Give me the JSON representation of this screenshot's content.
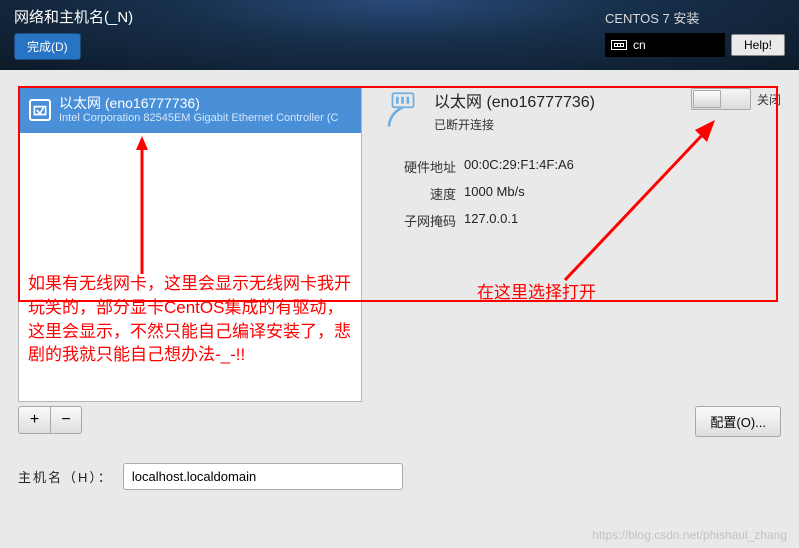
{
  "header": {
    "title": "网络和主机名(_N)",
    "done": "完成(D)",
    "install_label": "CENTOS 7 安装",
    "keyboard": "cn",
    "help": "Help!"
  },
  "network_item": {
    "name": "以太网 (eno16777736)",
    "sub": "Intel Corporation 82545EM Gigabit Ethernet Controller (C"
  },
  "detail": {
    "title": "以太网 (eno16777736)",
    "status": "已断开连接",
    "toggle_label": "关闭",
    "props": {
      "hw_label": "硬件地址",
      "hw_val": "00:0C:29:F1:4F:A6",
      "speed_label": "速度",
      "speed_val": "1000 Mb/s",
      "mask_label": "子网掩码",
      "mask_val": "127.0.0.1"
    }
  },
  "buttons": {
    "plus": "+",
    "minus": "−",
    "config": "配置(O)..."
  },
  "host": {
    "label": "主机名（H）：",
    "value": "localhost.localdomain"
  },
  "annotations": {
    "text1": "如果有无线网卡，这里会显示无线网卡我开玩笑的，部分显卡CentOS集成的有驱动，这里会显示，不然只能自己编译安装了，悲剧的我就只能自己想办法-_-!!",
    "text2": "在这里选择打开"
  },
  "watermark": "https://blog.csdn.net/phishaul_zhang"
}
